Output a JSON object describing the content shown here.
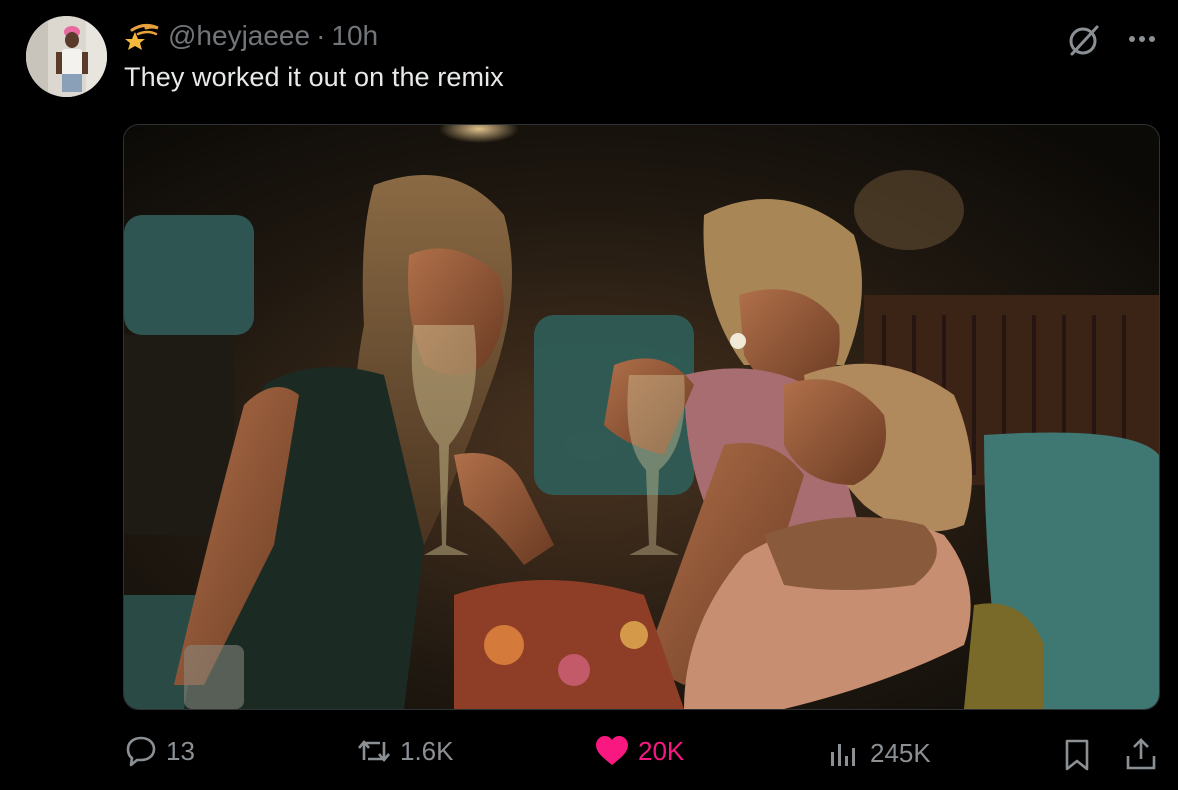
{
  "post": {
    "handle": "@heyjaeee",
    "separator": "·",
    "time": "10h",
    "text": "They worked it out on the remix",
    "badge_icon": "shooting-star-icon",
    "media_description_icon": "photo"
  },
  "actions": {
    "replies": "13",
    "reposts": "1.6K",
    "likes": "20K",
    "views": "245K"
  },
  "colors": {
    "background": "#000000",
    "text": "#e7e9ea",
    "muted": "#71767b",
    "like": "#f91880"
  }
}
